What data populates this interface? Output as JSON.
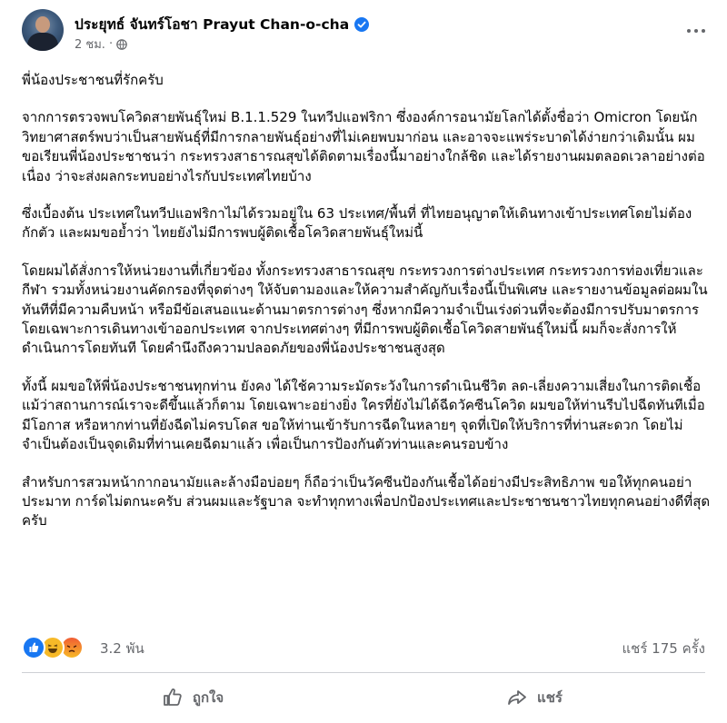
{
  "post": {
    "author": "ประยุทธ์ จันทร์โอชา Prayut Chan-o-cha",
    "time": "2 ชม.",
    "dot": "·",
    "paragraphs": [
      "พี่น้องประชาชนที่รักครับ",
      "จากการตรวจพบโควิดสายพันธุ์ใหม่ B.1.1.529 ในทวีปแอฟริกา ซึ่งองค์การอนามัยโลกได้ตั้งชื่อว่า Omicron โดยนักวิทยาศาสตร์พบว่าเป็นสายพันธุ์ที่มีการกลายพันธุ์อย่างที่ไม่เคยพบมาก่อน และอาจจะแพร่ระบาดได้ง่ายกว่าเดิมนั้น  ผมขอเรียนพี่น้องประชาชนว่า กระทรวงสาธารณสุขได้ติดตามเรื่องนี้มาอย่างใกล้ชิด  และได้รายงานผมตลอดเวลาอย่างต่อเนื่อง  ว่าจะส่งผลกระทบอย่างไรกับประเทศไทยบ้าง",
      "ซึ่งเบื้องต้น ประเทศในทวีปแอฟริกาไม่ได้รวมอยู่ใน 63 ประเทศ/พื้นที่  ที่ไทยอนุญาตให้เดินทางเข้าประเทศโดยไม่ต้องกักตัว และผมขอย้ำว่า ไทยยังไม่มีการพบผู้ติดเชื้อโควิดสายพันธุ์ใหม่นี้",
      "โดยผมได้สั่งการให้หน่วยงานที่เกี่ยวข้อง ทั้งกระทรวงสาธารณสุข กระทรวงการต่างประเทศ กระทรวงการท่องเที่ยวและกีฬา รวมทั้งหน่วยงานคัดกรองที่จุดต่างๆ ให้จับตามองและให้ความสำคัญกับเรื่องนี้เป็นพิเศษ และรายงานข้อมูลต่อผมในทันทีที่มีความคืบหน้า หรือมีข้อเสนอแนะด้านมาตรการต่างๆ ซึ่งหากมีความจำเป็นเร่งด่วนที่จะต้องมีการปรับมาตรการ โดยเฉพาะการเดินทางเข้าออกประเทศ จากประเทศต่างๆ ที่มีการพบผู้ติดเชื้อโควิดสายพันธุ์ใหม่นี้  ผมก็จะสั่งการให้ดำเนินการโดยทันที  โดยคำนึงถึงความปลอดภัยของพี่น้องประชาชนสูงสุด",
      "ทั้งนี้ ผมขอให้พี่น้องประชาชนทุกท่าน ยังคง ได้ใช้ความระมัดระวังในการดำเนินชีวิต ลด-เลี่ยงความเสี่ยงในการติดเชื้อ แม้ว่าสถานการณ์เราจะดีขึ้นแล้วก็ตาม โดยเฉพาะอย่างยิ่ง ใครที่ยังไม่ได้ฉีดวัคซีนโควิด ผมขอให้ท่านรีบไปฉีดทันทีเมื่อมีโอกาส  หรือหากท่านที่ยังฉีดไม่ครบโดส ขอให้ท่านเข้ารับการฉีดในหลายๆ  จุดที่เปิดให้บริการที่ท่านสะดวก โดยไม่จำเป็นต้องเป็นจุดเดิมที่ท่านเคยฉีดมาแล้ว เพื่อเป็นการป้องกันตัวท่านและคนรอบข้าง",
      "สำหรับการสวมหน้ากากอนามัยและล้างมือบ่อยๆ ก็ถือว่าเป็นวัคซีนป้องกันเชื้อได้อย่างมีประสิทธิภาพ ขอให้ทุกคนอย่าประมาท การ์ดไม่ตกนะครับ ส่วนผมและรัฐบาล จะทำทุกทางเพื่อปกป้องประเทศและประชาชนชาวไทยทุกคนอย่างดีที่สุดครับ"
    ],
    "reactions_count": "3.2 พัน",
    "shares": "แชร์ 175 ครั้ง"
  },
  "actions": {
    "like_label": "ถูกใจ",
    "share_label": "แชร์"
  },
  "colors": {
    "accent": "#1877f2",
    "secondary_text": "#65676b"
  },
  "icons": [
    "verified-icon",
    "globe-icon",
    "more-icon",
    "like-reaction-icon",
    "haha-reaction-icon",
    "angry-reaction-icon",
    "thumbs-up-icon",
    "share-arrow-icon"
  ]
}
